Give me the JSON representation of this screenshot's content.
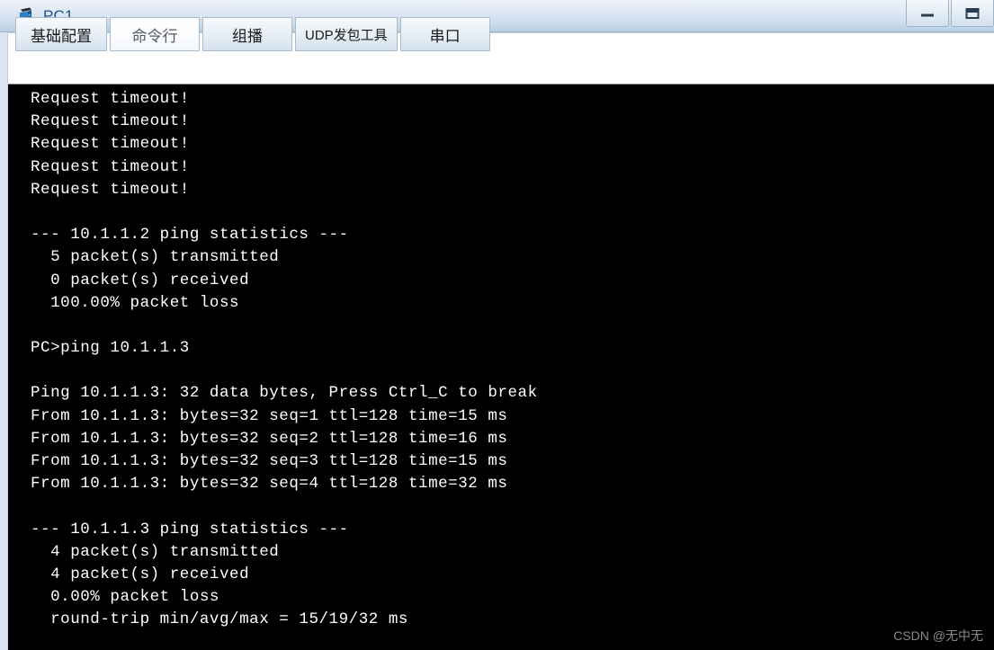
{
  "window": {
    "title": "PC1",
    "icon": "pc-device-icon",
    "controls": [
      {
        "name": "minimize-button",
        "glyph": "minimize-icon"
      },
      {
        "name": "maximize-button",
        "glyph": "maximize-icon"
      }
    ]
  },
  "tabs": [
    {
      "label": "基础配置",
      "selected": false
    },
    {
      "label": "命令行",
      "selected": true
    },
    {
      "label": "组播",
      "selected": false
    },
    {
      "label": "UDP发包工具",
      "selected": false
    },
    {
      "label": "串口",
      "selected": false
    }
  ],
  "terminal": {
    "prompt": "PC>",
    "lines": [
      "Request timeout!",
      "Request timeout!",
      "Request timeout!",
      "Request timeout!",
      "Request timeout!",
      "",
      "--- 10.1.1.2 ping statistics ---",
      "  5 packet(s) transmitted",
      "  0 packet(s) received",
      "  100.00% packet loss",
      "",
      "PC>ping 10.1.1.3",
      "",
      "Ping 10.1.1.3: 32 data bytes, Press Ctrl_C to break",
      "From 10.1.1.3: bytes=32 seq=1 ttl=128 time=15 ms",
      "From 10.1.1.3: bytes=32 seq=2 ttl=128 time=16 ms",
      "From 10.1.1.3: bytes=32 seq=3 ttl=128 time=15 ms",
      "From 10.1.1.3: bytes=32 seq=4 ttl=128 time=32 ms",
      "",
      "--- 10.1.1.3 ping statistics ---",
      "  4 packet(s) transmitted",
      "  4 packet(s) received",
      "  0.00% packet loss",
      "  round-trip min/avg/max = 15/19/32 ms"
    ]
  },
  "watermark": "CSDN @无中无",
  "colors": {
    "titlebar_top": "#eef3fa",
    "titlebar_bottom": "#b9cfe3",
    "title_text": "#1c4f8b",
    "terminal_bg": "#000000",
    "terminal_text": "#ffffff",
    "watermark": "#8a8a8a"
  }
}
